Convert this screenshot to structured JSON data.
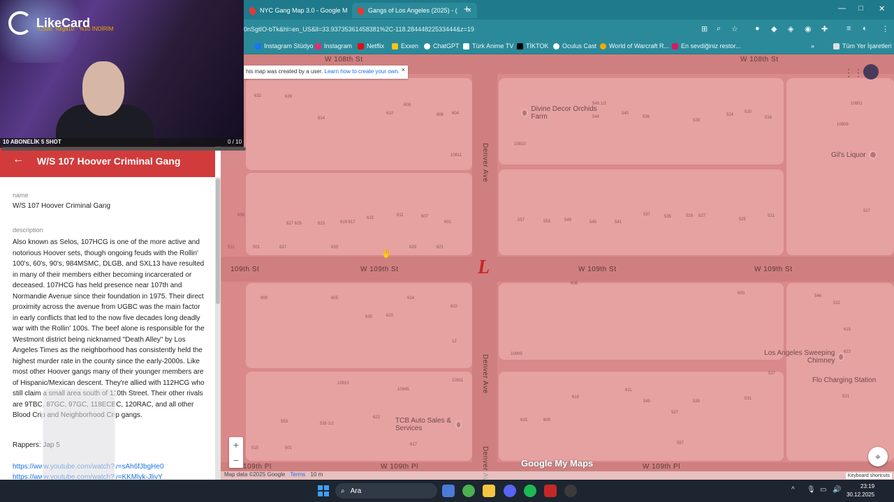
{
  "browser": {
    "tabs": [
      {
        "label": "NYC Gang Map 3.0 - Google M",
        "active": false
      },
      {
        "label": "Gangs of Los Angeles (2025) - (",
        "active": true
      }
    ],
    "new_tab": "+",
    "window_controls": {
      "minimize": "—",
      "maximize": "□",
      "close": "✕"
    },
    "url": "0nSgtIO-bTk&hl=en_US&ll=33.93735361458381%2C-118.28444822533444&z=19",
    "bookmarks": [
      {
        "label": "Instagram Stüdyo",
        "color": "#1877f2"
      },
      {
        "label": "Instagram",
        "color": "#e1306c"
      },
      {
        "label": "Netflix",
        "color": "#e50914"
      },
      {
        "label": "Exxen",
        "color": "#f5c518"
      },
      {
        "label": "ChatGPT",
        "color": "#ffffff"
      },
      {
        "label": "Türk Anime TV",
        "color": "#ffffff"
      },
      {
        "label": "TİKTOK",
        "color": "#000000"
      },
      {
        "label": "Oculus Cast",
        "color": "#ffffff"
      },
      {
        "label": "World of Warcraft R...",
        "color": "#f2a900"
      },
      {
        "label": "En sevdiğiniz restor...",
        "color": "#d81b60"
      }
    ],
    "bookmarks_more": "»",
    "all_bookmarks": "Tüm Yer İşaretleri"
  },
  "map": {
    "notice_text": "his map was created by a user.",
    "notice_link": "Learn how to create your own.",
    "notice_close": "×",
    "streets": {
      "top_left": "W 108th St",
      "top_right": "W 108th St",
      "mid_1": "109th St",
      "mid_2": "W 109th St",
      "mid_3": "W 109th St",
      "mid_4": "W 109th St",
      "bottom_left": "109th Pl",
      "bottom_mid": "W 109th Pl",
      "bottom_right": "W 109th Pl",
      "avenue_1": "Denver Ave",
      "avenue_2": "Denver Ave",
      "avenue_3": "Denver Ave"
    },
    "pois": [
      {
        "label": "Divine Decor Orchids Farm"
      },
      {
        "label": "Gil's Liquor"
      },
      {
        "label": "Los Angeles Sweeping Chimney"
      },
      {
        "label": "Flo Charging Station"
      },
      {
        "label": "TCB Auto Sales & Services"
      }
    ],
    "house_numbers": [
      "632",
      "626",
      "614",
      "610",
      "608",
      "606",
      "604",
      "548 1/2",
      "544",
      "540",
      "536",
      "528",
      "524",
      "520",
      "516",
      "10811",
      "10810",
      "10809",
      "10801",
      "636",
      "627 625",
      "623",
      "619 617",
      "615",
      "611",
      "607",
      "601",
      "557",
      "553",
      "549",
      "545",
      "541",
      "537",
      "535",
      "529",
      "527",
      "525",
      "521",
      "517",
      "511",
      "501",
      "637",
      "633",
      "629",
      "621",
      "609",
      "605",
      "630",
      "620",
      "614",
      "610",
      "608",
      "600",
      "546",
      "522",
      "12",
      "10909",
      "10911",
      "10910",
      "10945",
      "619",
      "611",
      "545",
      "537",
      "535",
      "531",
      "527",
      "521",
      "515",
      "501",
      "622",
      "617",
      "615",
      "609",
      "557",
      "553",
      "535 1/2",
      "623",
      "615",
      "10908",
      "10913"
    ],
    "brand_mark": "L",
    "logo": "Google My Maps",
    "attribution": "Map data ©2025 Google",
    "terms": "Terms",
    "scale": "10 m",
    "keyboard": "Keyboard shortcuts",
    "zoom_in": "+",
    "zoom_out": "−",
    "apps_icon": "⋮⋮⋮",
    "recenter_icon": "⌖"
  },
  "panel": {
    "title": "W/S 107 Hoover Criminal Gang",
    "back": "←",
    "name_label": "name",
    "name_value": "W/S 107 Hoover Criminal Gang",
    "description_label": "description",
    "description": "Also known as Selos, 107HCG is one of the more active and notorious Hoover sets, though ongoing feuds with the Rollin' 100's, 60's, 90's, 984MSMC, DLGB, and SXL13 have resulted in many of their members either becoming incarcerated or deceased. 107HCG has held presence near 107th and Normandie Avenue since their foundation in 1975. Their direct proximity across the avenue from UGBC was the main factor in early conflicts that led to the now five decades long deadly war with the Rollin' 100s. The beef alone is responsible for the Westmont district being nicknamed \"Death Alley\" by Los Angeles Times as the neighborhood has consistently held the highest murder rate in the county since the early-2000s. Like most other Hoover gangs many of their younger members are of Hispanic/Mexican descent. They're allied with 112HCG who still claim a small area south of 110th Street. Their other rivals are 9TBC, 87GC, 97GC, 118ECBC, 120RAC, and all other Blood Crip and Neighborhood Crip gangs.",
    "rappers": "Rappers: Jap 5",
    "links": [
      "https://www.youtube.com/watch?v=sAh6fJbgHe0",
      "https://www.youtube.com/watch?v=KKMlyk-JlivY"
    ]
  },
  "overlay": {
    "brand": "LikeCard",
    "brand_sub": "Code: Tolga10 · %10 İNDİRİM",
    "goal_label": "10 ABONELİK 5 SHOT",
    "goal_count": "0 / 10",
    "goal_progress": 0.0
  },
  "taskbar": {
    "search": "Ara",
    "time": "23:19",
    "date": "30.12.2025",
    "tray_expand": "^"
  }
}
